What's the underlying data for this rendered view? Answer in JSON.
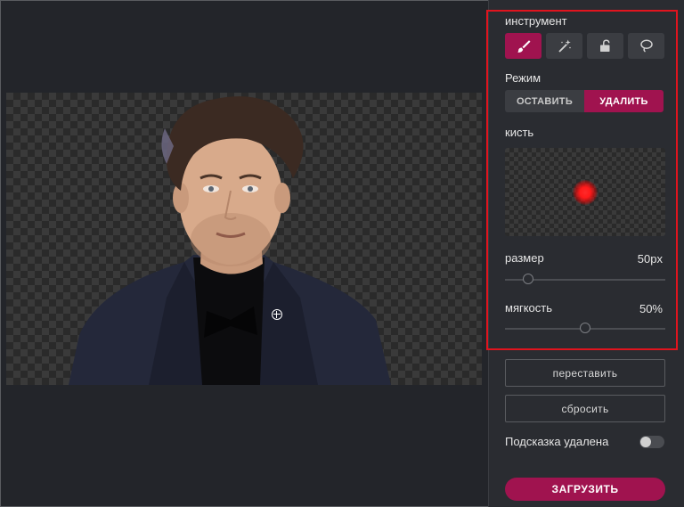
{
  "panel": {
    "tool_label": "инструмент",
    "tools": [
      {
        "icon": "brush-icon",
        "active": true
      },
      {
        "icon": "magic-wand-icon",
        "active": false
      },
      {
        "icon": "eraser-icon",
        "active": false
      },
      {
        "icon": "lasso-icon",
        "active": false
      }
    ],
    "mode_label": "Режим",
    "mode_keep": "ОСТАВИТЬ",
    "mode_delete": "УДАЛИТЬ",
    "brush_label": "кисть",
    "size_label": "размер",
    "size_value": "50px",
    "size_level": 0.12,
    "softness_label": "мягкость",
    "softness_value": "50%",
    "softness_level": 0.5,
    "reposition_button": "переставить",
    "reset_button": "сбросить",
    "hint_label": "Подсказка удалена",
    "hint_toggle_on": false,
    "upload_button": "ЗАГРУЗИТЬ"
  },
  "colors": {
    "accent": "#a0134f",
    "highlight_box": "#e0141e",
    "background": "#23252a"
  }
}
